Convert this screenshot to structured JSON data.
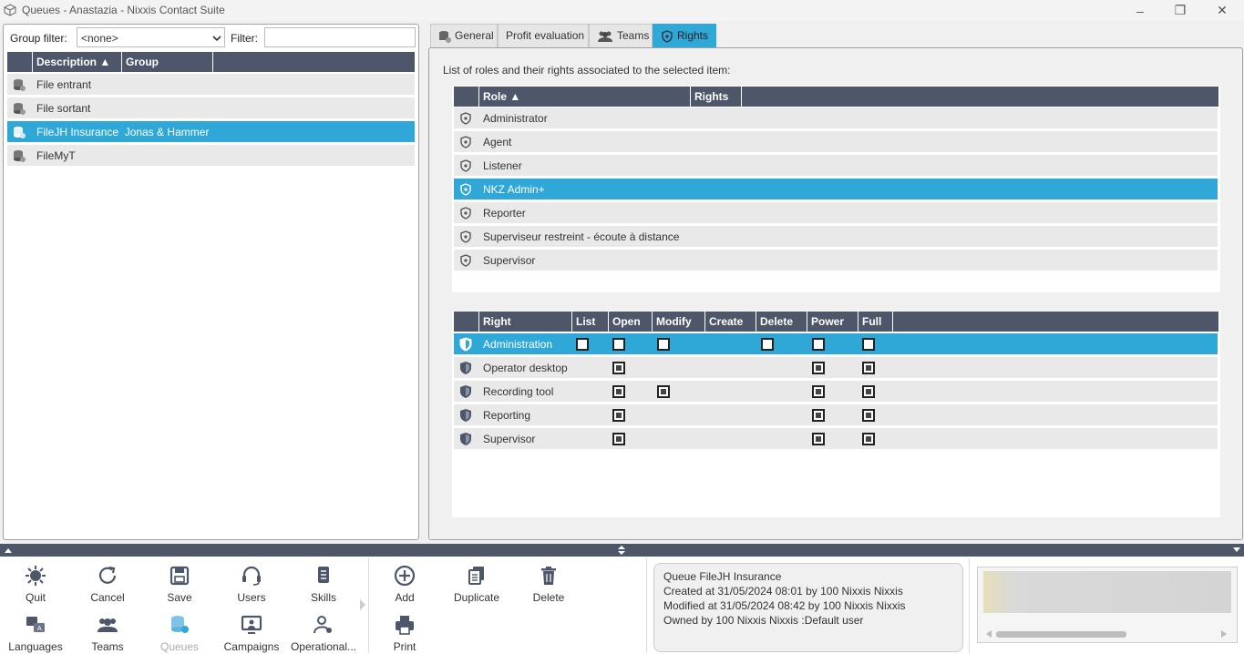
{
  "window": {
    "title": "Queues - Anastazia - Nixxis Contact Suite",
    "minimize": "–",
    "restore": "❐",
    "close": "✕"
  },
  "left": {
    "group_filter_label": "Group filter:",
    "group_filter_value": "<none>",
    "filter_label": "Filter:",
    "filter_value": "",
    "headers": {
      "description": "Description ▲",
      "group": "Group"
    },
    "rows": [
      {
        "text": "File entrant"
      },
      {
        "text": "File sortant"
      },
      {
        "text": "FileJH Insurance  Jonas & Hammer"
      },
      {
        "text": "FileMyT"
      }
    ]
  },
  "tabs": {
    "general": "General",
    "profit": "Profit evaluation",
    "teams": "Teams",
    "rights": "Rights"
  },
  "rights": {
    "intro": "List of roles and their rights associated to the selected item:",
    "role_headers": {
      "role": "Role ▲",
      "rights": "Rights"
    },
    "roles": [
      {
        "text": "Administrator"
      },
      {
        "text": "Agent"
      },
      {
        "text": "Listener"
      },
      {
        "text": "NKZ Admin+"
      },
      {
        "text": "Reporter"
      },
      {
        "text": "Superviseur restreint - écoute à distance"
      },
      {
        "text": "Supervisor"
      }
    ],
    "right_headers": {
      "right": "Right",
      "list": "List",
      "open": "Open",
      "modify": "Modify",
      "create": "Create",
      "delete": "Delete",
      "power": "Power",
      "full": "Full"
    },
    "rights_rows": [
      {
        "text": "Administration"
      },
      {
        "text": "Operator desktop"
      },
      {
        "text": "Recording tool"
      },
      {
        "text": "Reporting"
      },
      {
        "text": "Supervisor"
      }
    ]
  },
  "toolbar": {
    "quit": "Quit",
    "cancel": "Cancel",
    "save": "Save",
    "users": "Users",
    "skills": "Skills",
    "languages": "Languages",
    "teams": "Teams",
    "queues": "Queues",
    "campaigns": "Campaigns",
    "operational": "Operational...",
    "add": "Add",
    "duplicate": "Duplicate",
    "delete": "Delete",
    "print": "Print"
  },
  "info": {
    "line1": "Queue FileJH Insurance",
    "line2": "Created at 31/05/2024 08:01 by 100 Nixxis Nixxis",
    "line3": "Modified at 31/05/2024 08:42 by 100 Nixxis Nixxis",
    "line4": "Owned by 100 Nixxis Nixxis :Default user"
  },
  "colors": {
    "header": "#4d5769",
    "selection": "#2fa8d8",
    "row": "#e9e9e9"
  }
}
